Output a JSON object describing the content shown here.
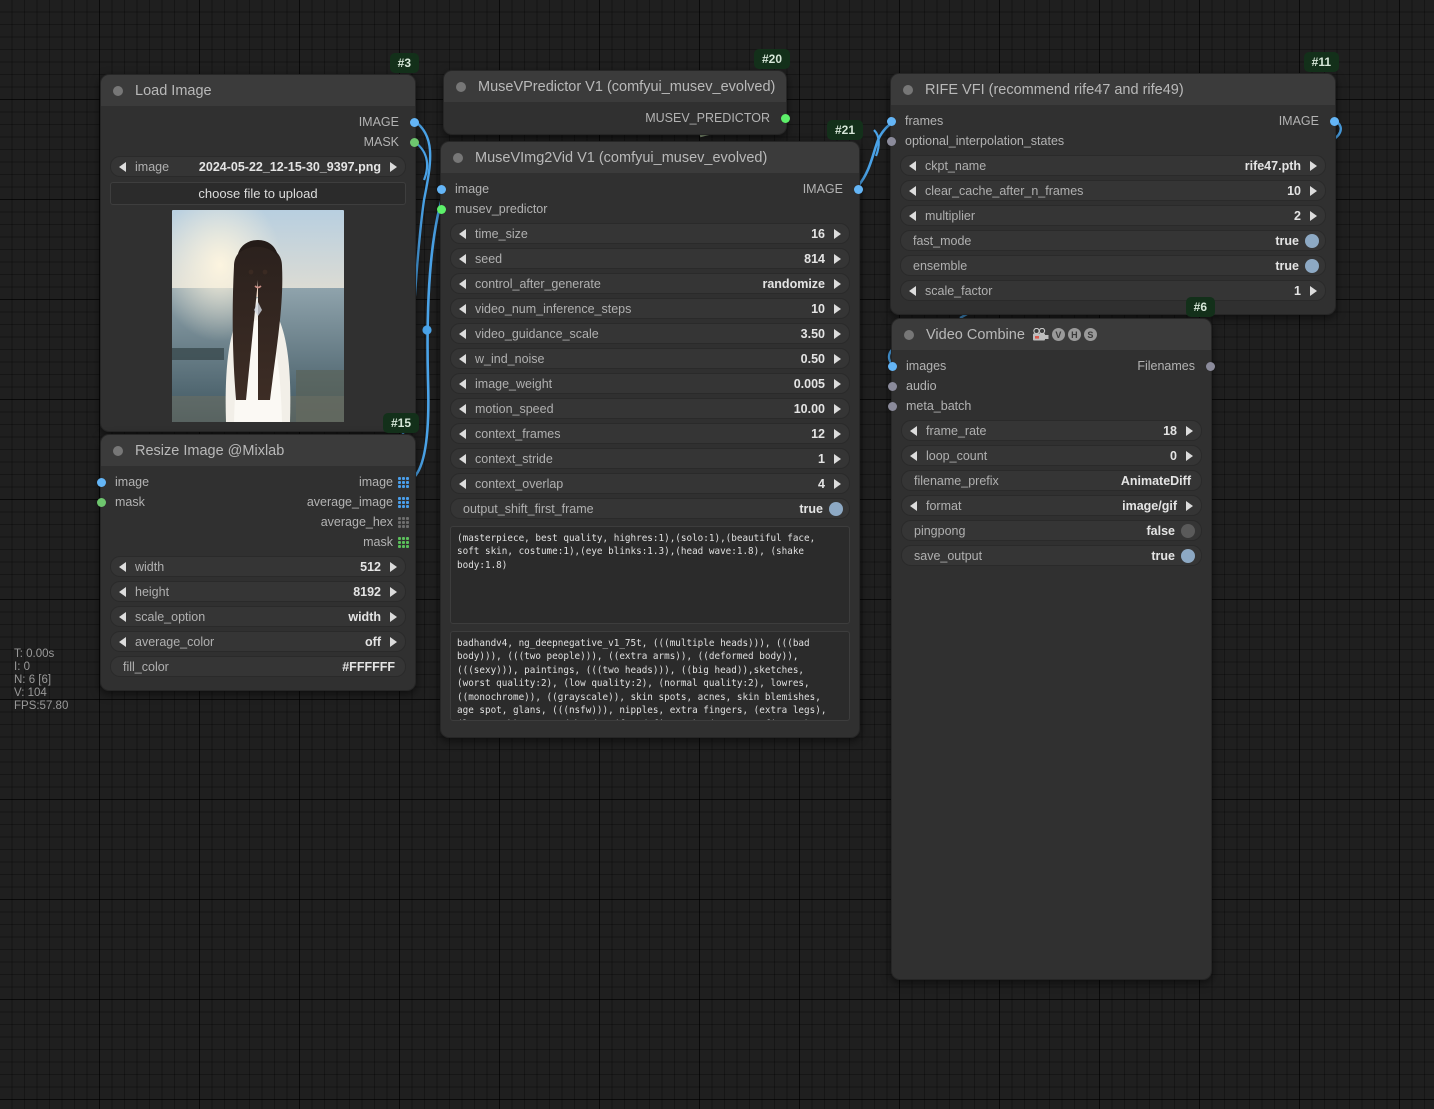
{
  "canvas": {
    "stats": [
      "T: 0.00s",
      "I: 0",
      "N: 6 [6]",
      "V: 104",
      "FPS:57.80"
    ],
    "colors": {
      "image_link": "#4aa3e8",
      "musev_link": "#8fa382",
      "node_bg": "#303030",
      "node_header": "#3b3b3b",
      "badge_bg": "#13301a"
    }
  },
  "nodes": {
    "load_image": {
      "id_badge": "#3",
      "title": "Load Image",
      "outputs": [
        {
          "label": "IMAGE",
          "type": "IMAGE"
        },
        {
          "label": "MASK",
          "type": "MASK"
        }
      ],
      "widgets": [
        {
          "name": "image",
          "value": "2024-05-22_12-15-30_9397.png",
          "kind": "combo"
        }
      ],
      "upload_button": "choose file to upload",
      "preview_alt": "portrait of woman with long dark hair in white cardigan by the sea at sunset"
    },
    "resize_image": {
      "id_badge": "#15",
      "title": "Resize Image @Mixlab",
      "inputs": [
        {
          "label": "image",
          "type": "IMAGE"
        },
        {
          "label": "mask",
          "type": "MASK"
        }
      ],
      "outputs": [
        {
          "label": "image",
          "type": "IMAGE"
        },
        {
          "label": "average_image",
          "type": "IMAGE"
        },
        {
          "label": "average_hex",
          "type": "STRING"
        },
        {
          "label": "mask",
          "type": "MASK"
        }
      ],
      "widgets": [
        {
          "name": "width",
          "value": "512",
          "kind": "number"
        },
        {
          "name": "height",
          "value": "8192",
          "kind": "number"
        },
        {
          "name": "scale_option",
          "value": "width",
          "kind": "combo"
        },
        {
          "name": "average_color",
          "value": "off",
          "kind": "combo"
        },
        {
          "name": "fill_color",
          "value": "#FFFFFF",
          "kind": "text"
        }
      ]
    },
    "musev_predictor": {
      "id_badge": "#20",
      "title": "MuseVPredictor V1 (comfyui_musev_evolved)",
      "outputs": [
        {
          "label": "MUSEV_PREDICTOR",
          "type": "MUSEV_PREDICTOR"
        }
      ]
    },
    "musev_img2vid": {
      "id_badge": "#21",
      "title": "MuseVImg2Vid V1 (comfyui_musev_evolved)",
      "inputs": [
        {
          "label": "image",
          "type": "IMAGE"
        },
        {
          "label": "musev_predictor",
          "type": "MUSEV_PREDICTOR"
        }
      ],
      "outputs": [
        {
          "label": "IMAGE",
          "type": "IMAGE"
        }
      ],
      "widgets": [
        {
          "name": "time_size",
          "value": "16",
          "kind": "number"
        },
        {
          "name": "seed",
          "value": "814",
          "kind": "number"
        },
        {
          "name": "control_after_generate",
          "value": "randomize",
          "kind": "combo"
        },
        {
          "name": "video_num_inference_steps",
          "value": "10",
          "kind": "number"
        },
        {
          "name": "video_guidance_scale",
          "value": "3.50",
          "kind": "number"
        },
        {
          "name": "w_ind_noise",
          "value": "0.50",
          "kind": "number"
        },
        {
          "name": "image_weight",
          "value": "0.005",
          "kind": "number"
        },
        {
          "name": "motion_speed",
          "value": "10.00",
          "kind": "number"
        },
        {
          "name": "context_frames",
          "value": "12",
          "kind": "number"
        },
        {
          "name": "context_stride",
          "value": "1",
          "kind": "number"
        },
        {
          "name": "context_overlap",
          "value": "4",
          "kind": "number"
        },
        {
          "name": "output_shift_first_frame",
          "value": "true",
          "kind": "boolean"
        }
      ],
      "prompt": "(masterpiece, best quality, highres:1),(solo:1),(beautiful face, soft skin, costume:1),(eye blinks:1.3),(head wave:1.8), (shake body:1.8)",
      "negative_prompt": "badhandv4, ng_deepnegative_v1_75t, (((multiple heads))), (((bad body))), (((two people))), ((extra arms)), ((deformed body)), (((sexy))), paintings, (((two heads))), ((big head)),sketches, (worst quality:2), (low quality:2), (normal quality:2), lowres, ((monochrome)), ((grayscale)), skin spots, acnes, skin blemishes, age spot, glans, (((nsfw))), nipples, extra fingers, (extra legs), (long neck), mutated hands, (fused fingers), (too many fingers)"
    },
    "rife_vfi": {
      "id_badge": "#11",
      "title": "RIFE VFI (recommend rife47 and rife49)",
      "inputs": [
        {
          "label": "frames",
          "type": "IMAGE"
        },
        {
          "label": "optional_interpolation_states",
          "type": "OPTIONAL"
        }
      ],
      "outputs": [
        {
          "label": "IMAGE",
          "type": "IMAGE"
        }
      ],
      "widgets": [
        {
          "name": "ckpt_name",
          "value": "rife47.pth",
          "kind": "combo"
        },
        {
          "name": "clear_cache_after_n_frames",
          "value": "10",
          "kind": "number"
        },
        {
          "name": "multiplier",
          "value": "2",
          "kind": "number"
        },
        {
          "name": "fast_mode",
          "value": "true",
          "kind": "boolean"
        },
        {
          "name": "ensemble",
          "value": "true",
          "kind": "boolean"
        },
        {
          "name": "scale_factor",
          "value": "1",
          "kind": "number"
        }
      ]
    },
    "video_combine": {
      "id_badge": "#6",
      "title": "Video Combine",
      "title_icons": [
        "film-camera-icon",
        "V",
        "H",
        "S"
      ],
      "inputs": [
        {
          "label": "images",
          "type": "IMAGE"
        },
        {
          "label": "audio",
          "type": "AUDIO"
        },
        {
          "label": "meta_batch",
          "type": "META_BATCH"
        }
      ],
      "outputs": [
        {
          "label": "Filenames",
          "type": "VHS_FILENAMES"
        }
      ],
      "widgets": [
        {
          "name": "frame_rate",
          "value": "18",
          "kind": "number"
        },
        {
          "name": "loop_count",
          "value": "0",
          "kind": "number"
        },
        {
          "name": "filename_prefix",
          "value": "AnimateDiff",
          "kind": "text"
        },
        {
          "name": "format",
          "value": "image/gif",
          "kind": "combo"
        },
        {
          "name": "pingpong",
          "value": "false",
          "kind": "boolean"
        },
        {
          "name": "save_output",
          "value": "true",
          "kind": "boolean"
        }
      ]
    }
  }
}
